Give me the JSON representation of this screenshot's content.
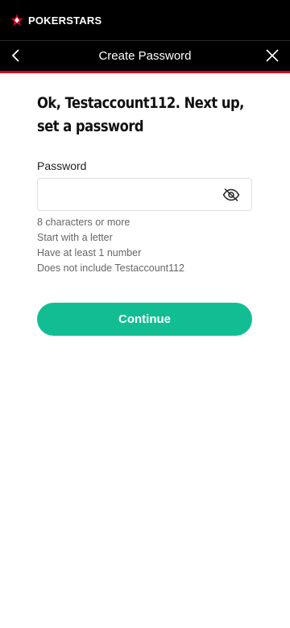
{
  "brand": {
    "name": "POKERSTARS",
    "logo_icon": "star-spade-icon",
    "logo_color": "#d70022"
  },
  "nav": {
    "title": "Create Password",
    "back_icon": "chevron-left-icon",
    "close_icon": "close-icon"
  },
  "main": {
    "heading": "Ok, Testaccount112. Next up, set a password",
    "password_label": "Password",
    "password_value": "",
    "visibility_icon": "eye-off-icon",
    "requirements": [
      "8 characters or more",
      "Start with a letter",
      "Have at least 1 number",
      "Does not include Testaccount112"
    ],
    "continue_label": "Continue"
  },
  "colors": {
    "accent": "#12bd94",
    "brand_red": "#d70022",
    "header_bg": "#000000"
  }
}
